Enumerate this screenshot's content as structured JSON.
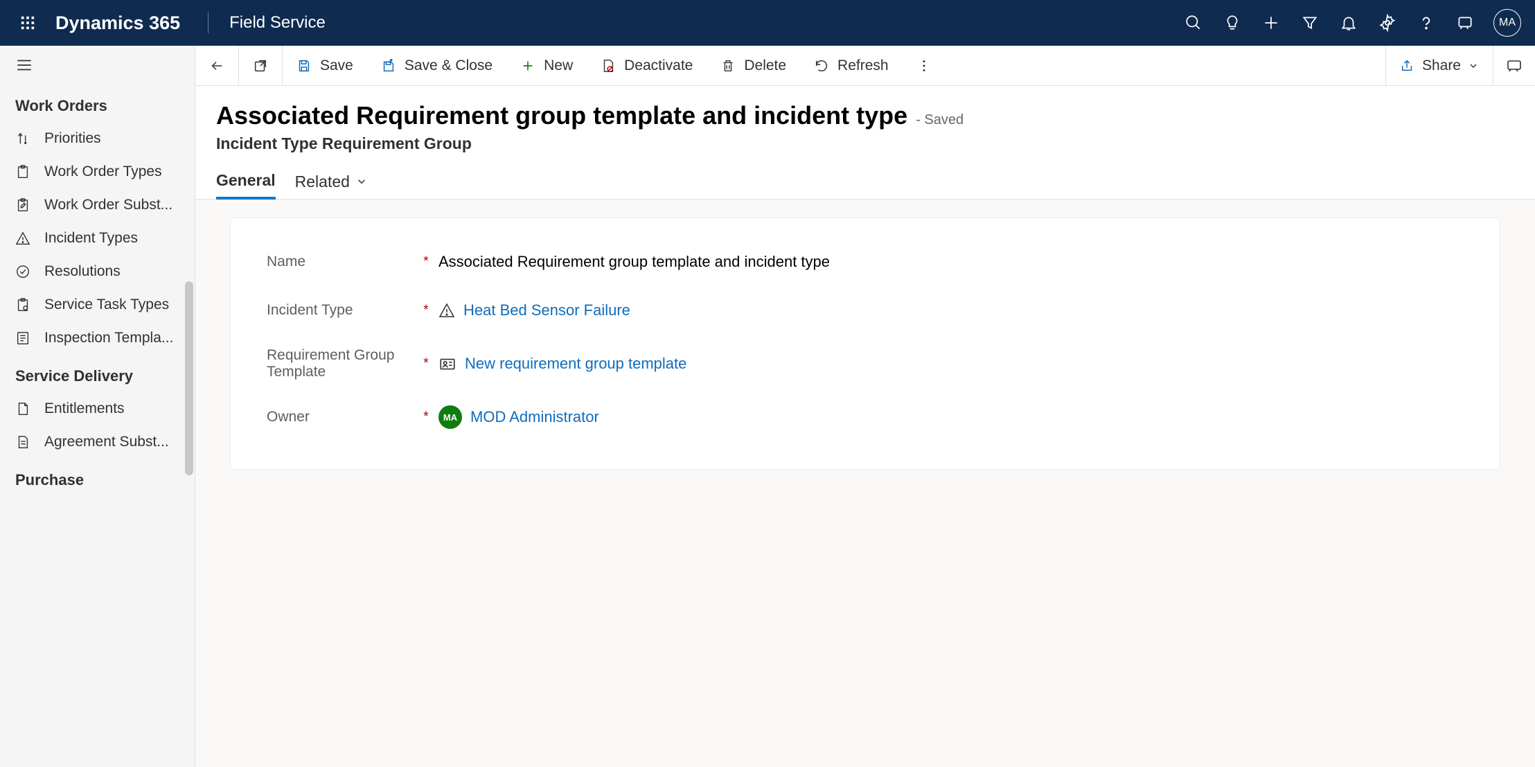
{
  "header": {
    "brand": "Dynamics 365",
    "app_name": "Field Service",
    "user_initials": "MA"
  },
  "sidebar": {
    "groups": [
      {
        "title": "Work Orders",
        "items": [
          {
            "label": "Priorities",
            "name": "priorities"
          },
          {
            "label": "Work Order Types",
            "name": "work-order-types"
          },
          {
            "label": "Work Order Subst...",
            "name": "work-order-subst"
          },
          {
            "label": "Incident Types",
            "name": "incident-types"
          },
          {
            "label": "Resolutions",
            "name": "resolutions"
          },
          {
            "label": "Service Task Types",
            "name": "service-task-types"
          },
          {
            "label": "Inspection Templa...",
            "name": "inspection-templates"
          }
        ]
      },
      {
        "title": "Service Delivery",
        "items": [
          {
            "label": "Entitlements",
            "name": "entitlements"
          },
          {
            "label": "Agreement Subst...",
            "name": "agreement-subst"
          }
        ]
      },
      {
        "title": "Purchase",
        "items": []
      }
    ]
  },
  "cmdbar": {
    "save": "Save",
    "save_close": "Save & Close",
    "new": "New",
    "deactivate": "Deactivate",
    "delete": "Delete",
    "refresh": "Refresh",
    "share": "Share"
  },
  "form": {
    "title": "Associated Requirement group template and incident type",
    "status": "- Saved",
    "subtitle": "Incident Type Requirement Group",
    "tabs": {
      "general": "General",
      "related": "Related"
    },
    "fields": {
      "name": {
        "label": "Name",
        "value": "Associated Requirement group template and incident type"
      },
      "incident_type": {
        "label": "Incident Type",
        "value": "Heat Bed Sensor Failure"
      },
      "req_group_template": {
        "label": "Requirement Group Template",
        "value": "New requirement group template"
      },
      "owner": {
        "label": "Owner",
        "value": "MOD Administrator",
        "initials": "MA"
      }
    }
  }
}
